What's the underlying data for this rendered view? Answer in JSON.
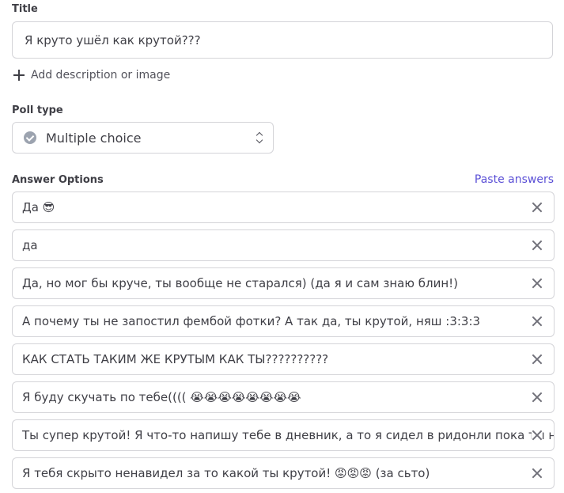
{
  "title_section": {
    "label": "Title",
    "value": "Я круто ушёл как крутой???"
  },
  "add_description_label": "Add description or image",
  "poll_type": {
    "label": "Poll type",
    "selected": "Multiple choice"
  },
  "answers": {
    "label": "Answer Options",
    "paste_label": "Paste answers",
    "options": [
      "Да 😎",
      "да",
      "Да, но мог бы круче, ты вообще не старался) (да я и сам знаю блин!)",
      "А почему ты не запостил фембой фотки? А так да, ты крутой, няш :3:3:3",
      "КАК СТАТЬ ТАКИМ ЖЕ КРУТЫМ КАК ТЫ??????????",
      "Я буду скучать по тебе(((( 😭😭😭😭😭😭😭😭",
      "Ты супер крутой! Я что-то напишу тебе в дневник, а то я сидел в ридонли пока ты не",
      "Я тебя скрыто ненавидел за то какой ты крутой! 😡😡😡 (за сьто)"
    ]
  }
}
